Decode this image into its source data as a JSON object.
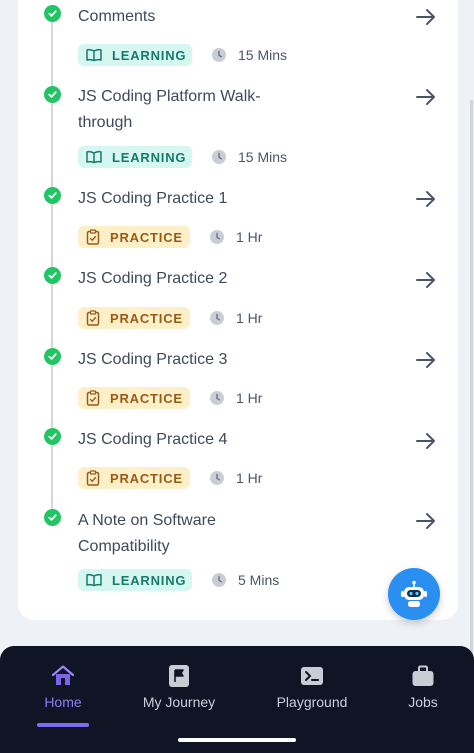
{
  "items": [
    {
      "title": "Comments",
      "type_label": "LEARNING",
      "duration": "15 Mins"
    },
    {
      "title": "JS Coding Platform Walk-through",
      "type_label": "LEARNING",
      "duration": "15 Mins"
    },
    {
      "title": "JS Coding Practice 1",
      "type_label": "PRACTICE",
      "duration": "1 Hr"
    },
    {
      "title": "JS Coding Practice 2",
      "type_label": "PRACTICE",
      "duration": "1 Hr"
    },
    {
      "title": "JS Coding Practice 3",
      "type_label": "PRACTICE",
      "duration": "1 Hr"
    },
    {
      "title": "JS Coding Practice 4",
      "type_label": "PRACTICE",
      "duration": "1 Hr"
    },
    {
      "title": "A Note on Software Compatibility",
      "type_label": "LEARNING",
      "duration": "5 Mins"
    }
  ],
  "nav": {
    "home": "Home",
    "journey": "My Journey",
    "playground": "Playground",
    "jobs": "Jobs"
  },
  "colors": {
    "check": "#23c463",
    "learning_bg": "#d5f6f1",
    "learning_text": "#177a6b",
    "practice_bg": "#fdf0c9",
    "practice_text": "#9a5a14",
    "nav_bg": "#0f1525",
    "nav_active": "#8e7cf3",
    "bot_button": "#2a8ff0"
  },
  "icons": {
    "status": "check-circle-icon",
    "open": "arrow-right-icon",
    "learning": "book-icon",
    "practice": "clipboard-icon",
    "duration": "clock-icon",
    "assistant": "robot-icon",
    "home": "home-icon",
    "journey": "flag-icon",
    "playground": "terminal-icon",
    "jobs": "briefcase-icon"
  }
}
